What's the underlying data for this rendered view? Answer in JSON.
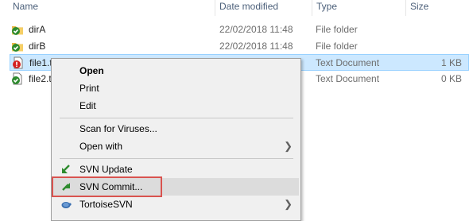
{
  "header": {
    "name": "Name",
    "date": "Date modified",
    "type": "Type",
    "size": "Size"
  },
  "rows": [
    {
      "name": "dirA",
      "date": "22/02/2018 11:48",
      "type": "File folder",
      "size": "",
      "icon": "folder-green-check-icon"
    },
    {
      "name": "dirB",
      "date": "22/02/2018 11:48",
      "type": "File folder",
      "size": "",
      "icon": "folder-green-check-icon"
    },
    {
      "name": "file1.t",
      "date": "",
      "type": "Text Document",
      "size": "1 KB",
      "icon": "file-red-modified-icon"
    },
    {
      "name": "file2.t",
      "date": "",
      "type": "Text Document",
      "size": "0 KB",
      "icon": "file-green-check-icon"
    }
  ],
  "menu": {
    "open": "Open",
    "print": "Print",
    "edit": "Edit",
    "scan": "Scan for Viruses...",
    "open_with": "Open with",
    "svn_update": "SVN Update",
    "svn_commit": "SVN Commit...",
    "tortoise": "TortoiseSVN"
  },
  "colors": {
    "selection": "#cce8ff",
    "highlight_border": "#d9534f",
    "svn_green": "#2e8b2e"
  }
}
